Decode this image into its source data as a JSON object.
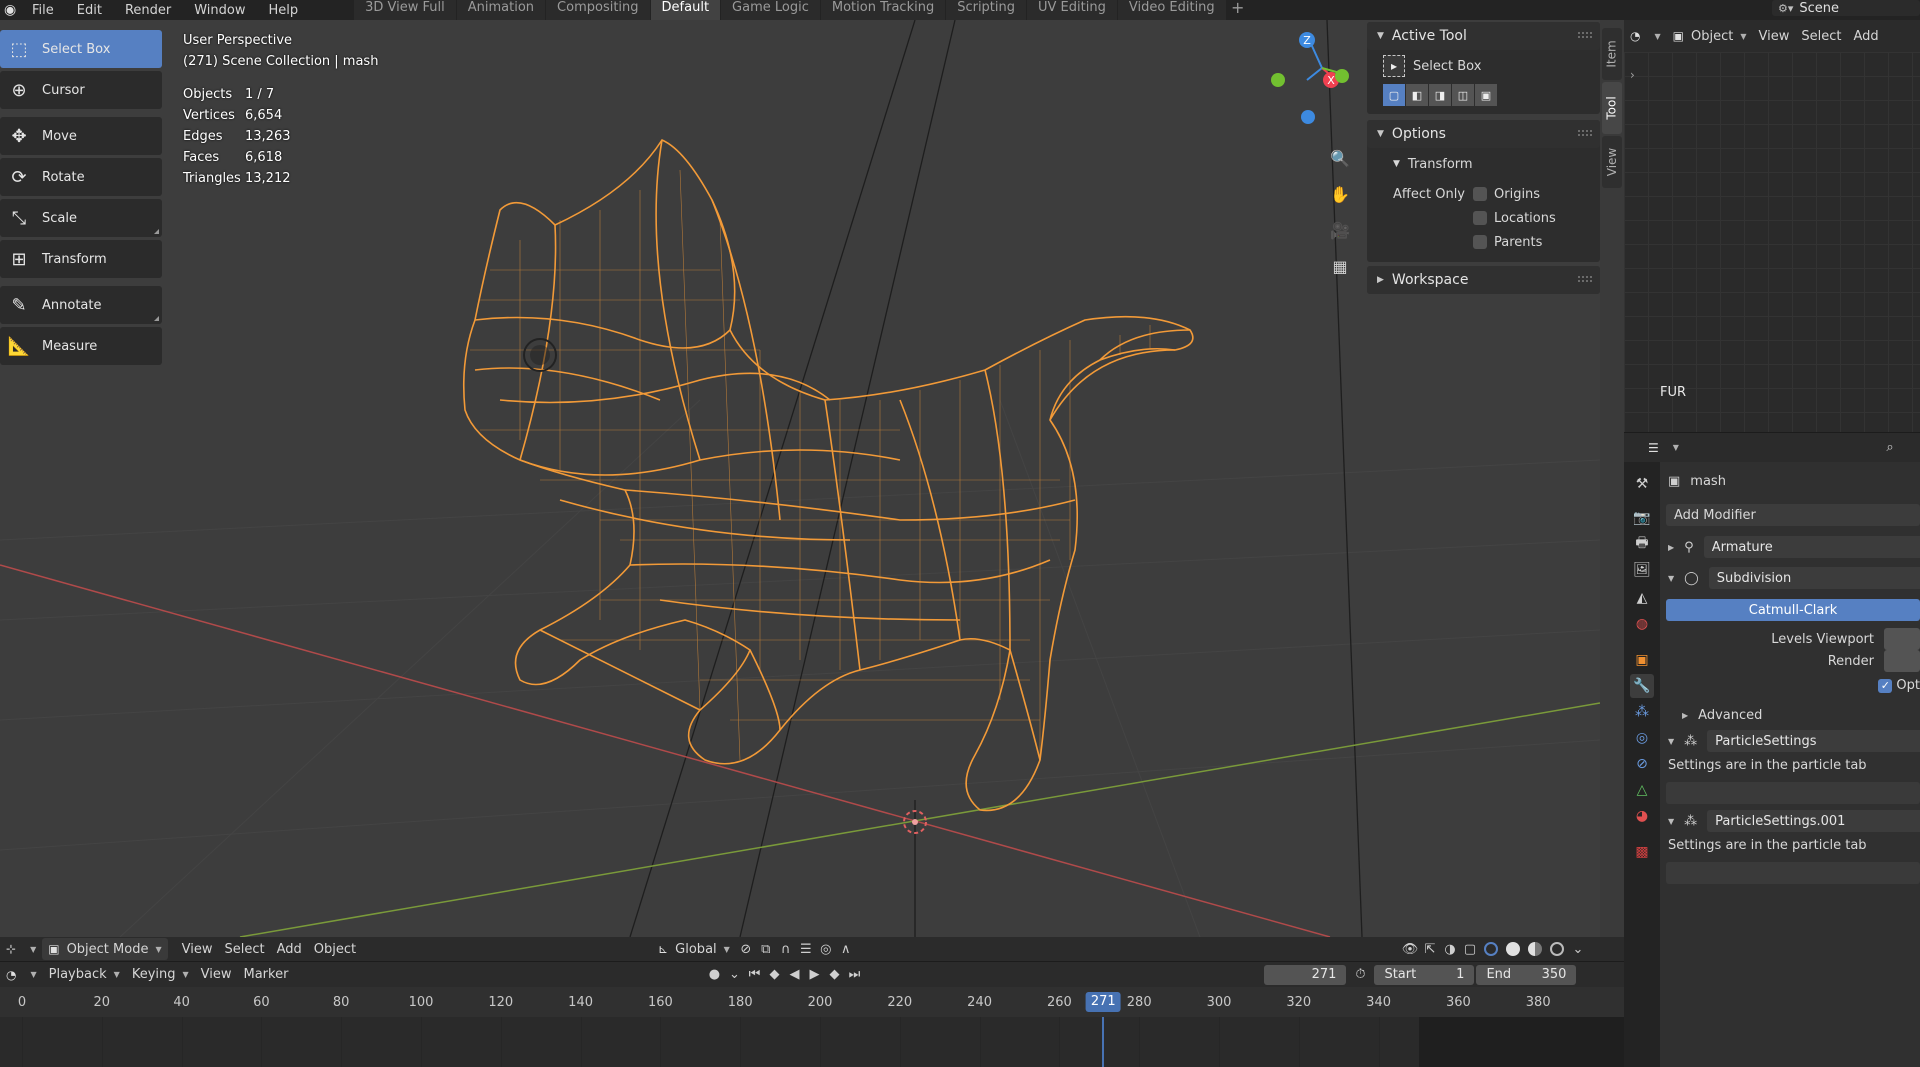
{
  "topbar": {
    "menus": [
      "File",
      "Edit",
      "Render",
      "Window",
      "Help"
    ],
    "tabs": [
      "3D View Full",
      "Animation",
      "Compositing",
      "Default",
      "Game Logic",
      "Motion Tracking",
      "Scripting",
      "UV Editing",
      "Video Editing"
    ],
    "active_tab": "Default",
    "add_tab": "+",
    "scene": "Scene"
  },
  "toolbar": {
    "tools": [
      {
        "label": "Select Box",
        "icon": "select-box-icon",
        "active": true
      },
      {
        "label": "Cursor",
        "icon": "cursor-icon"
      },
      {
        "label": "Move",
        "icon": "move-icon"
      },
      {
        "label": "Rotate",
        "icon": "rotate-icon"
      },
      {
        "label": "Scale",
        "icon": "scale-icon"
      },
      {
        "label": "Transform",
        "icon": "transform-icon"
      },
      {
        "label": "Annotate",
        "icon": "annotate-icon"
      },
      {
        "label": "Measure",
        "icon": "measure-icon"
      }
    ]
  },
  "overlay": {
    "view_name": "User Perspective",
    "collection": "(271) Scene Collection | mash",
    "stats": [
      {
        "key": "Objects",
        "value": "1 / 7"
      },
      {
        "key": "Vertices",
        "value": "6,654"
      },
      {
        "key": "Edges",
        "value": "13,263"
      },
      {
        "key": "Faces",
        "value": "6,618"
      },
      {
        "key": "Triangles",
        "value": "13,212"
      }
    ]
  },
  "gizmo": {
    "x": "X",
    "y": "Y",
    "z": "Z"
  },
  "npanel": {
    "active_tool": {
      "title": "Active Tool",
      "tool_name": "Select Box"
    },
    "options": {
      "title": "Options",
      "transform": "Transform",
      "affect_only": "Affect Only",
      "items": [
        {
          "label": "Origins",
          "checked": false
        },
        {
          "label": "Locations",
          "checked": false
        },
        {
          "label": "Parents",
          "checked": false
        }
      ]
    },
    "workspace": {
      "title": "Workspace"
    }
  },
  "sidetabs": [
    "Item",
    "Tool",
    "View"
  ],
  "active_sidetab": "Tool",
  "vp_header": {
    "mode": "Object Mode",
    "menus": [
      "View",
      "Select",
      "Add",
      "Object"
    ],
    "orientation": "Global"
  },
  "timeline": {
    "menus": [
      "Playback",
      "Keying",
      "View",
      "Marker"
    ],
    "current_frame": "271",
    "start_label": "Start",
    "start": "1",
    "end_label": "End",
    "end": "350",
    "ticks": [
      "0",
      "20",
      "40",
      "60",
      "80",
      "100",
      "120",
      "140",
      "160",
      "180",
      "200",
      "220",
      "240",
      "260",
      "280",
      "300",
      "320",
      "340",
      "360",
      "380"
    ],
    "playhead_label": "271"
  },
  "outliner": {
    "mode": "Object",
    "menus": [
      "View",
      "Select",
      "Add"
    ],
    "item": "FUR"
  },
  "properties": {
    "object_name": "mash",
    "add_modifier": "Add Modifier",
    "modifiers": [
      {
        "name": "Armature",
        "expanded": false
      },
      {
        "name": "Subdivision",
        "expanded": true
      }
    ],
    "subdiv_type": "Catmull-Clark",
    "levels_viewport": "Levels Viewport",
    "render": "Render",
    "opt": "Opt",
    "advanced": "Advanced",
    "particles": [
      {
        "name": "ParticleSettings",
        "note": "Settings are in the particle tab"
      },
      {
        "name": "ParticleSettings.001",
        "note": "Settings are in the particle tab"
      }
    ]
  },
  "colors": {
    "accent": "#5680c2",
    "wire": "#f29a38",
    "axis_x": "#b04a4a",
    "axis_y": "#7a9a3a",
    "gizmo_x": "#f04050",
    "gizmo_y": "#72c030",
    "gizmo_z": "#3d8ae0"
  }
}
